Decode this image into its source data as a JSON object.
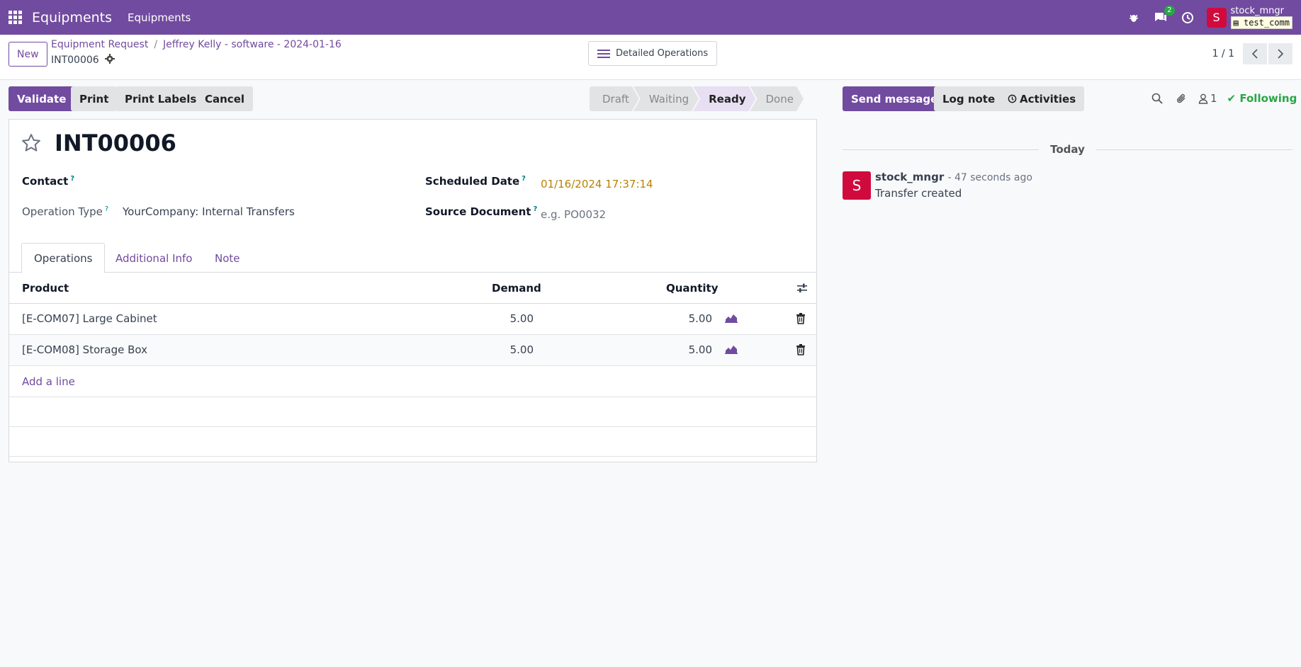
{
  "navbar": {
    "app_name": "Equipments",
    "menu": "Equipments",
    "chat_badge": "2",
    "user_initial": "S",
    "user_name": "stock_mngr",
    "db_name": "test_comm"
  },
  "control": {
    "new_label": "New",
    "breadcrumb_1": "Equipment Request",
    "breadcrumb_sep": "/",
    "breadcrumb_2": "Jeffrey Kelly - software - 2024-01-16",
    "record_ref": "INT00006",
    "detailed_ops": "Detailed Operations",
    "pager": "1 / 1"
  },
  "actions": {
    "validate": "Validate",
    "print": "Print",
    "print_labels": "Print Labels",
    "cancel": "Cancel"
  },
  "status": {
    "stages": [
      "Draft",
      "Waiting",
      "Ready",
      "Done"
    ],
    "active": "Ready"
  },
  "form": {
    "title": "INT00006",
    "contact_label": "Contact",
    "operation_type_label": "Operation Type",
    "operation_type_value": "YourCompany: Internal Transfers",
    "scheduled_date_label": "Scheduled Date",
    "scheduled_date_value": "01/16/2024 17:37:14",
    "source_document_label": "Source Document",
    "source_document_placeholder": "e.g. PO0032",
    "help_mark": "?"
  },
  "tabs": [
    "Operations",
    "Additional Info",
    "Note"
  ],
  "table": {
    "headers": {
      "product": "Product",
      "demand": "Demand",
      "quantity": "Quantity"
    },
    "rows": [
      {
        "product": "[E-COM07] Large Cabinet",
        "demand": "5.00",
        "quantity": "5.00"
      },
      {
        "product": "[E-COM08] Storage Box",
        "demand": "5.00",
        "quantity": "5.00"
      }
    ],
    "add_line": "Add a line"
  },
  "chatter": {
    "send_message": "Send message",
    "log_note": "Log note",
    "activities": "Activities",
    "followers_count": "1",
    "following": "Following",
    "today": "Today",
    "message": {
      "avatar": "S",
      "author": "stock_mngr",
      "time": "- 47 seconds ago",
      "body": "Transfer created"
    }
  },
  "colors": {
    "brand": "#714b9f",
    "date_warning": "#b88300",
    "following": "#28a745",
    "avatar": "#d10a3d"
  }
}
